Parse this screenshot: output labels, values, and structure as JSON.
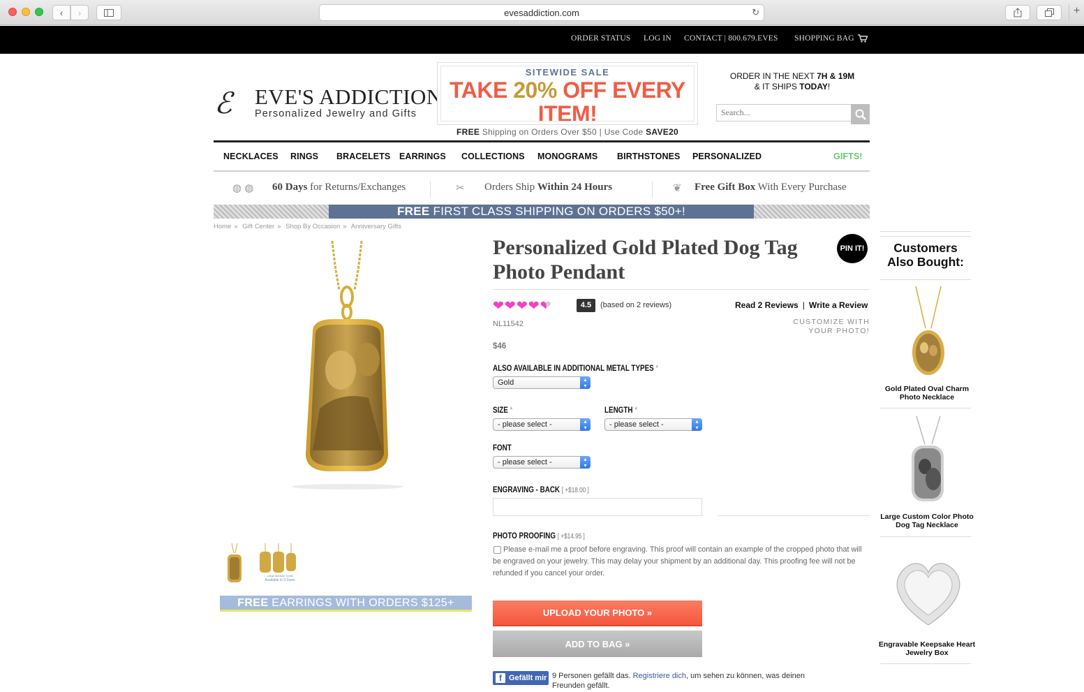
{
  "browser": {
    "url": "evesaddiction.com"
  },
  "topbar": {
    "order_status": "ORDER STATUS",
    "log_in": "LOG IN",
    "contact": "CONTACT | 800.679.EVES",
    "shopping_bag": "SHOPPING BAG"
  },
  "logo": {
    "name": "EVE'S ADDICTION",
    "tagline": "Personalized Jewelry and Gifts"
  },
  "promo": {
    "top": "SITEWIDE SALE",
    "main_prefix": "TAKE ",
    "main_pct": "20%",
    "main_suffix": " OFF EVERY ITEM!",
    "sub_free": "FREE",
    "sub_text": " Shipping on Orders Over $50 | Use Code ",
    "sub_code": "SAVE20"
  },
  "order_next": {
    "line1_prefix": "ORDER IN THE NEXT ",
    "line1_time": "7H & 19M",
    "line2_prefix": "& IT SHIPS ",
    "line2_when": "TODAY",
    "line2_suffix": "!"
  },
  "search": {
    "placeholder": "Search..."
  },
  "nav": [
    "NECKLACES",
    "RINGS",
    "BRACELETS",
    "EARRINGS",
    "COLLECTIONS",
    "MONOGRAMS",
    "BIRTHSTONES",
    "PERSONALIZED",
    "GIFTS!"
  ],
  "perks": {
    "p1_bold": "60 Days",
    "p1_text": " for Returns/Exchanges",
    "p2_text": "Orders Ship ",
    "p2_bold": "Within 24 Hours",
    "p3_bold": "Free Gift Box",
    "p3_text": " With Every Purchase"
  },
  "ship_banner": {
    "bold": "FREE",
    "text": " FIRST CLASS SHIPPING ON ORDERS $50+!"
  },
  "breadcrumb": [
    "Home",
    "Gift Center",
    "Shop By Occasion",
    "Anniversary Gifts"
  ],
  "product": {
    "title": "Personalized Gold Plated Dog Tag Photo Pendant",
    "pin_it": "PIN IT!",
    "rating": "4.5",
    "rating_hearts": 4.5,
    "reviews_basis": "(based on 2 reviews)",
    "read_reviews": "Read 2 Reviews",
    "write_review": "Write a Review",
    "sku": "NL11542",
    "customize": "CUSTOMIZE WITH YOUR PHOTO!",
    "price": "$46",
    "metal_label": "ALSO AVAILABLE IN ADDITIONAL METAL TYPES",
    "metal_value": "Gold",
    "size_label": "SIZE",
    "size_value": "- please select -",
    "length_label": "LENGTH",
    "length_value": "- please select -",
    "font_label": "FONT",
    "font_value": "- please select -",
    "engraving_label": "ENGRAVING - BACK",
    "engraving_addon": "[ +$18.00 ]",
    "proofing_label": "PHOTO PROOFING",
    "proofing_addon": "[ +$14.95 ]",
    "proofing_text": "Please e-mail me a proof before engraving. This proof will contain an example of the cropped photo that will be engraved on your jewelry. This may delay your shipment by an additional day. This proofing fee will not be refunded if you cancel your order.",
    "upload_button": "UPLOAD YOUR PHOTO »",
    "add_button": "ADD TO BAG »",
    "thumb_caption_sizes": "Large Medium Small",
    "thumb_caption": "Available in 3 Sizes"
  },
  "free_earrings": {
    "bold": "FREE",
    "text": " EARRINGS WITH ORDERS $125+"
  },
  "facebook": {
    "like": "Gefällt mir",
    "text_prefix": "9 Personen gefällt das. ",
    "link": "Registriere dich",
    "text_suffix": ", um sehen zu können, was deinen Freunden gefällt."
  },
  "sidebar": {
    "title": "Customers Also Bought:",
    "items": [
      {
        "name": "Gold Plated Oval Charm Photo Necklace"
      },
      {
        "name": "Large Custom Color Photo Dog Tag Necklace"
      },
      {
        "name": "Engravable Keepsake Heart Jewelry Box"
      }
    ]
  }
}
